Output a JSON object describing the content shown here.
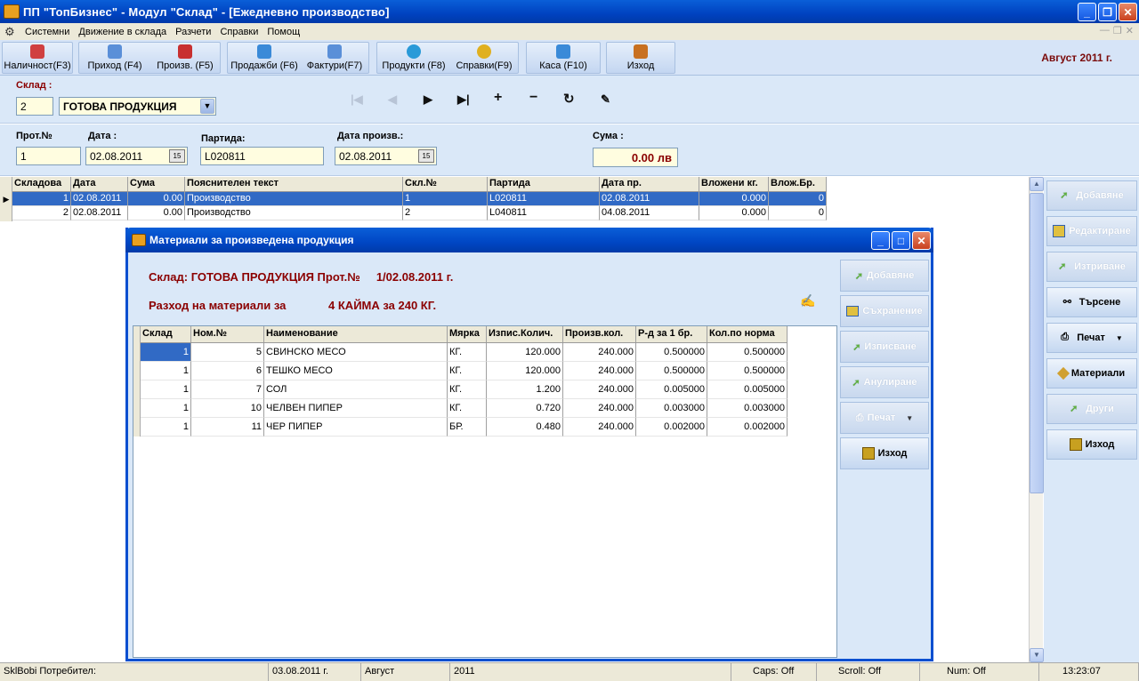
{
  "window": {
    "title": "ПП \"ТопБизнес\" - Модул \"Склад\" - [Ежедневно производство]",
    "minimize": "_",
    "restore": "❐",
    "close": "✕"
  },
  "menu": [
    "Системни",
    "Движение в склада",
    "Разчети",
    "Справки",
    "Помощ"
  ],
  "toolbar": {
    "buttons": [
      {
        "label": "Наличност(F3)",
        "color": "#d04040"
      },
      {
        "label": "Приход (F4)",
        "color": "#5a8fd8"
      },
      {
        "label": "Произв. (F5)",
        "color": "#c83030"
      },
      {
        "label": "Продажби (F6)",
        "color": "#3a8ad8"
      },
      {
        "label": "Фактури(F7)",
        "color": "#5a8fd8"
      },
      {
        "label": "Продукти (F8)",
        "color": "#2a9ad8"
      },
      {
        "label": "Справки(F9)",
        "color": "#e0b020"
      },
      {
        "label": "Каса (F10)",
        "color": "#3a8ad8"
      },
      {
        "label": "Изход",
        "color": "#c87020"
      }
    ],
    "period": "Август 2011 г."
  },
  "warehouse": {
    "label": "Склад :",
    "code": "2",
    "name": "ГОТОВА ПРОДУКЦИЯ"
  },
  "nav": {
    "first": "|◀",
    "prev": "◀",
    "next": "▶",
    "last": "▶|",
    "add": "+",
    "remove": "−",
    "refresh": "↻",
    "edit": "✎"
  },
  "header_form": {
    "prot_label": "Прот.№",
    "prot_value": "1",
    "date_label": "Дата :",
    "date_value": "02.08.2011",
    "batch_label": "Партида:",
    "batch_value": "L020811",
    "prod_date_label": "Дата произв.:",
    "prod_date_value": "02.08.2011",
    "sum_label": "Сума :",
    "sum_value": "0.00 лв",
    "cal_icon": "15"
  },
  "main_grid": {
    "columns": [
      "Складова",
      "Дата",
      "Сума",
      "Пояснителен текст",
      "Скл.№",
      "Партида",
      "Дата пр.",
      "Вложени кг.",
      "Влож.Бр."
    ],
    "rows": [
      [
        "1",
        "02.08.2011",
        "0.00",
        "Производство",
        "1",
        "L020811",
        "02.08.2011",
        "0.000",
        "0"
      ],
      [
        "2",
        "02.08.2011",
        "0.00",
        "Производство",
        "2",
        "L040811",
        "04.08.2011",
        "0.000",
        "0"
      ]
    ]
  },
  "right_panel": {
    "add": "Добавяне",
    "edit": "Редактиране",
    "delete": "Изтриване",
    "search": "Търсене",
    "print": "Печат",
    "materials": "Материали",
    "other": "Други",
    "exit": "Изход"
  },
  "dialog": {
    "title": "Материали за произведена продукция",
    "line1": "Склад: ГОТОВА ПРОДУКЦИЯ Прот.№     1/02.08.2011 г.",
    "line2_a": "Разход на материали за",
    "line2_b": "4 КАЙМА за 240 КГ.",
    "columns": [
      "Склад",
      "Ном.№",
      "Наименование",
      "Мярка",
      "Изпис.Колич.",
      "Произв.кол.",
      "Р-д за 1 бр.",
      "Кол.по норма"
    ],
    "rows": [
      [
        "1",
        "5",
        "СВИНСКО МЕСО",
        "КГ.",
        "120.000",
        "240.000",
        "0.500000",
        "0.500000"
      ],
      [
        "1",
        "6",
        "ТЕШКО МЕСО",
        "КГ.",
        "120.000",
        "240.000",
        "0.500000",
        "0.500000"
      ],
      [
        "1",
        "7",
        "СОЛ",
        "КГ.",
        "1.200",
        "240.000",
        "0.005000",
        "0.005000"
      ],
      [
        "1",
        "10",
        "ЧЕЛВЕН ПИПЕР",
        "КГ.",
        "0.720",
        "240.000",
        "0.003000",
        "0.003000"
      ],
      [
        "1",
        "11",
        "ЧЕР ПИПЕР",
        "БР.",
        "0.480",
        "240.000",
        "0.002000",
        "0.002000"
      ]
    ],
    "buttons": {
      "add": "Добавяне",
      "save": "Съхранение",
      "issue": "Изписване",
      "cancel": "Анулиране",
      "print": "Печат",
      "exit": "Изход"
    }
  },
  "status": {
    "user": "SklBobi Потребител:",
    "date": "03.08.2011 г.",
    "month": "Август",
    "year": "2011",
    "caps": "Caps: Off",
    "scroll": "Scroll: Off",
    "num": "Num: Off",
    "time": "13:23:07"
  }
}
